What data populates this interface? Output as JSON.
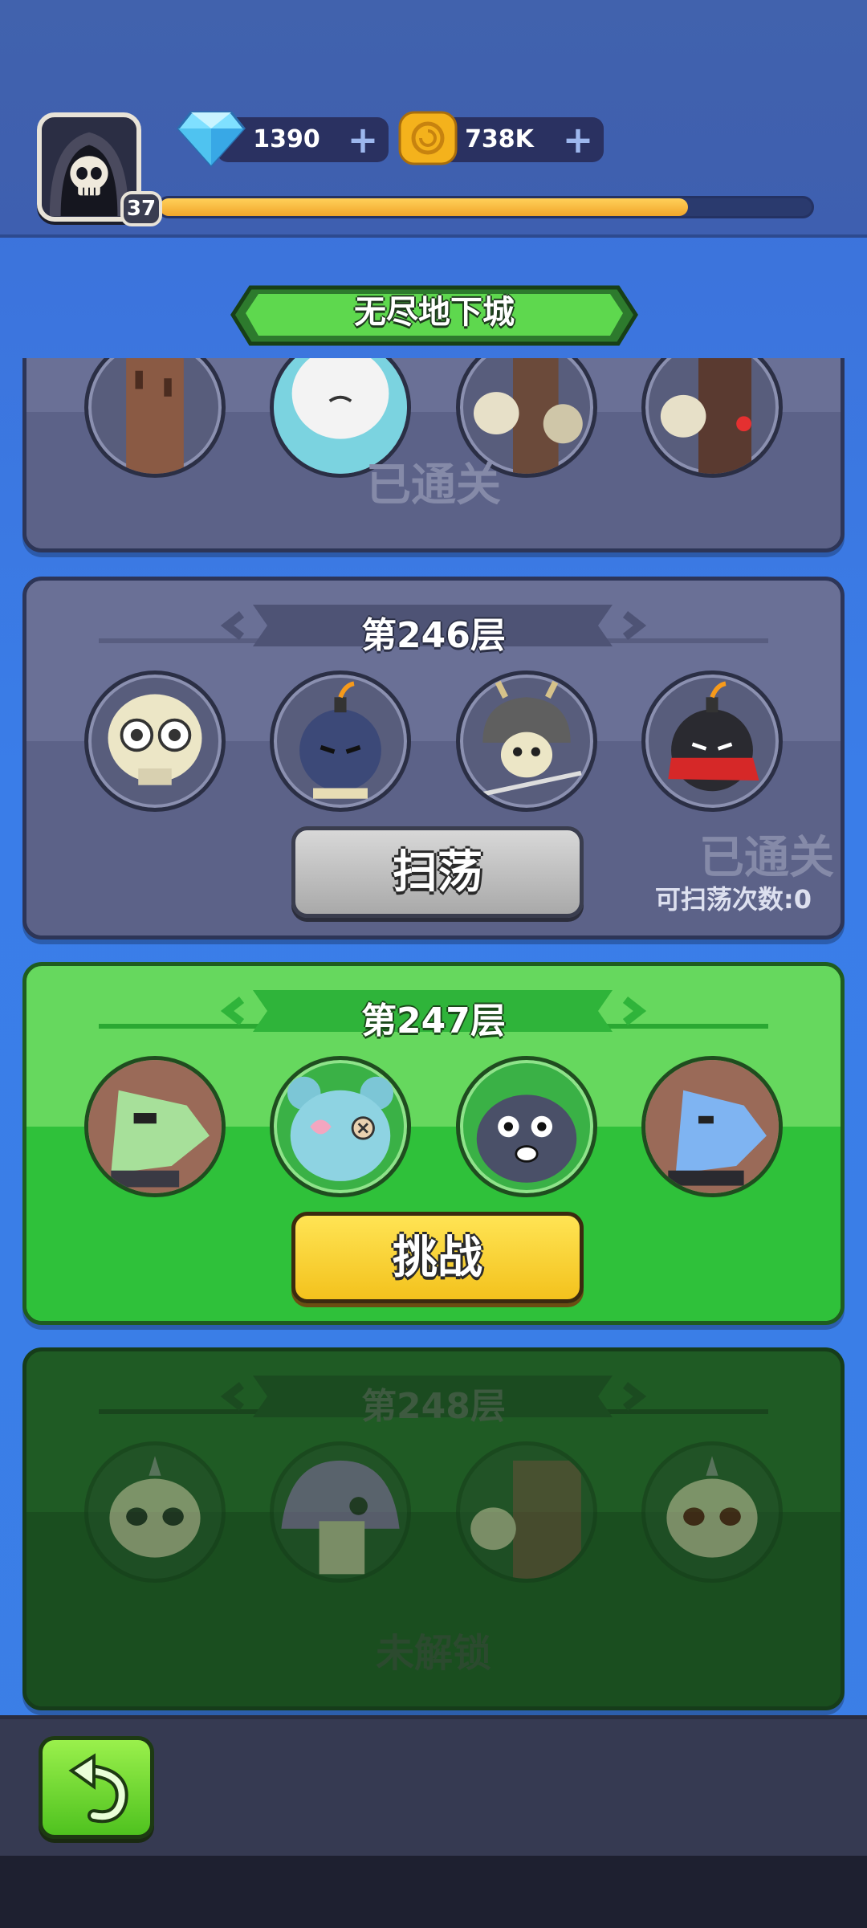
{
  "player": {
    "level": "37",
    "xp_progress": 0.81
  },
  "resources": {
    "gems": "1390",
    "coins": "738K",
    "gem_icon": "diamond-icon",
    "coin_icon": "coin-icon",
    "add_symbol": "+"
  },
  "screen": {
    "title": "无尽地下城"
  },
  "floors": [
    {
      "title": "",
      "status": "已通关",
      "enemies": [
        "tree-monster-icon",
        "ghost-icon",
        "skeleton-icon",
        "skeleton-icon"
      ]
    },
    {
      "title": "第246层",
      "status": "已通关",
      "button": "扫荡",
      "sweep_count": "可扫荡次数:0",
      "enemies": [
        "skull-icon",
        "bomb-icon",
        "samurai-skeleton-icon",
        "ninja-bomb-icon"
      ]
    },
    {
      "title": "第247层",
      "button": "挑战",
      "enemies": [
        "zombie-dog-icon",
        "stitched-bear-icon",
        "dark-bug-icon",
        "blue-dog-icon"
      ]
    },
    {
      "title": "第248层",
      "status": "未解锁",
      "enemies": [
        "horned-skull-icon",
        "mushroom-icon",
        "skeleton-box-icon",
        "red-eye-skull-icon"
      ]
    }
  ],
  "colors": {
    "card_cleared": "#6a7096",
    "card_active": "#66d85e",
    "card_locked": "#1f5b24",
    "button_challenge": "#f3c21d",
    "button_sweep": "#bdbdbd"
  },
  "navigation": {
    "back_icon": "back-arrow-icon"
  }
}
